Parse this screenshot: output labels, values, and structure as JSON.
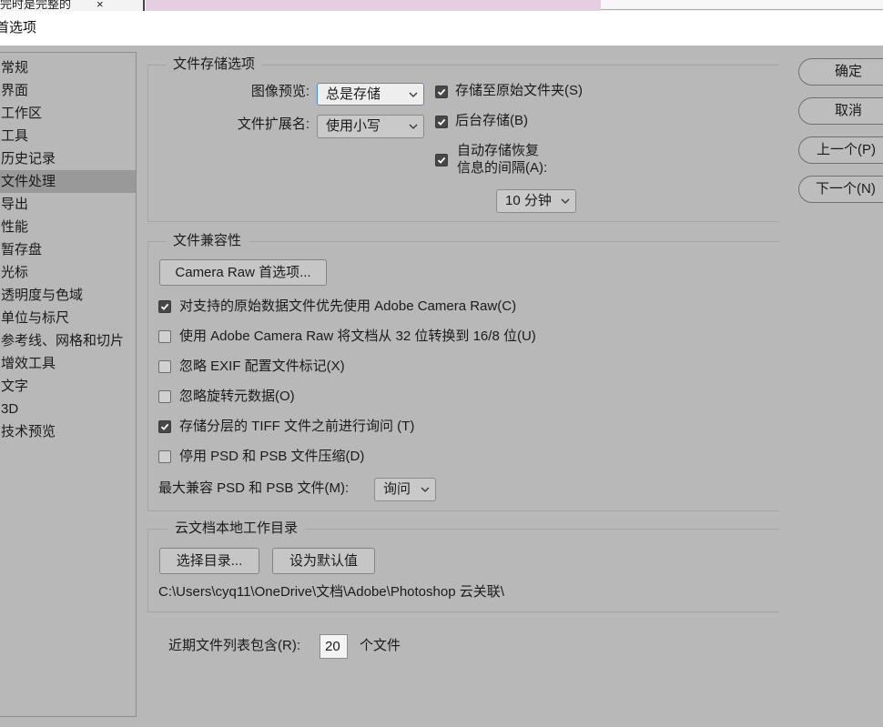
{
  "top_strip": {
    "tab_title": "完时是完整的",
    "close_glyph": "×"
  },
  "window": {
    "title": "首选项"
  },
  "sidebar": {
    "items": [
      {
        "label": "常规",
        "selected": false
      },
      {
        "label": "界面",
        "selected": false
      },
      {
        "label": "工作区",
        "selected": false
      },
      {
        "label": "工具",
        "selected": false
      },
      {
        "label": "历史记录",
        "selected": false
      },
      {
        "label": "文件处理",
        "selected": true
      },
      {
        "label": "导出",
        "selected": false
      },
      {
        "label": "性能",
        "selected": false
      },
      {
        "label": "暂存盘",
        "selected": false
      },
      {
        "label": "光标",
        "selected": false
      },
      {
        "label": "透明度与色域",
        "selected": false
      },
      {
        "label": "单位与标尺",
        "selected": false
      },
      {
        "label": "参考线、网格和切片",
        "selected": false
      },
      {
        "label": "增效工具",
        "selected": false
      },
      {
        "label": "文字",
        "selected": false
      },
      {
        "label": "3D",
        "selected": false
      },
      {
        "label": "技术预览",
        "selected": false
      }
    ]
  },
  "file_saving": {
    "title": "文件存储选项",
    "image_preview_label": "图像预览:",
    "image_preview_value": "总是存储",
    "extension_label": "文件扩展名:",
    "extension_value": "使用小写",
    "save_to_original": {
      "label": "存储至原始文件夹(S)",
      "checked": true
    },
    "background_save": {
      "label": "后台存储(B)",
      "checked": true
    },
    "autosave": {
      "label_line1": "自动存储恢复",
      "label_line2": "信息的间隔(A):",
      "checked": true
    },
    "autosave_interval": "10 分钟"
  },
  "compat": {
    "title": "文件兼容性",
    "camera_raw_button": "Camera Raw 首选项...",
    "options": [
      {
        "label": "对支持的原始数据文件优先使用 Adobe Camera Raw(C)",
        "checked": true
      },
      {
        "label": "使用 Adobe Camera Raw 将文档从 32 位转换到 16/8 位(U)",
        "checked": false
      },
      {
        "label": "忽略 EXIF 配置文件标记(X)",
        "checked": false
      },
      {
        "label": "忽略旋转元数据(O)",
        "checked": false
      },
      {
        "label": "存储分层的 TIFF 文件之前进行询问 (T)",
        "checked": true
      },
      {
        "label": "停用 PSD 和 PSB 文件压缩(D)",
        "checked": false
      }
    ],
    "max_compat_label": "最大兼容 PSD 和 PSB 文件(M):",
    "max_compat_value": "询问"
  },
  "cloud": {
    "title": "云文档本地工作目录",
    "choose_button": "选择目录...",
    "default_button": "设为默认值",
    "path": "C:\\Users\\cyq11\\OneDrive\\文档\\Adobe\\Photoshop 云关联\\"
  },
  "recent": {
    "label": "近期文件列表包含(R):",
    "value": "20",
    "unit": "个文件"
  },
  "buttons": {
    "ok": "确定",
    "cancel": "取消",
    "prev": "上一个(P)",
    "next": "下一个(N)"
  },
  "icons": {
    "dropdown": "chevron-down-icon",
    "checkbox_mark": "check-icon",
    "tab_close": "close-icon"
  },
  "colors": {
    "dialog_bg": "#b8b8b8",
    "selected_item_bg": "#999999",
    "focus_border": "#4a8be0",
    "checkbox_checked_fill": "#474747",
    "strip_pink": "#e6cde2"
  }
}
